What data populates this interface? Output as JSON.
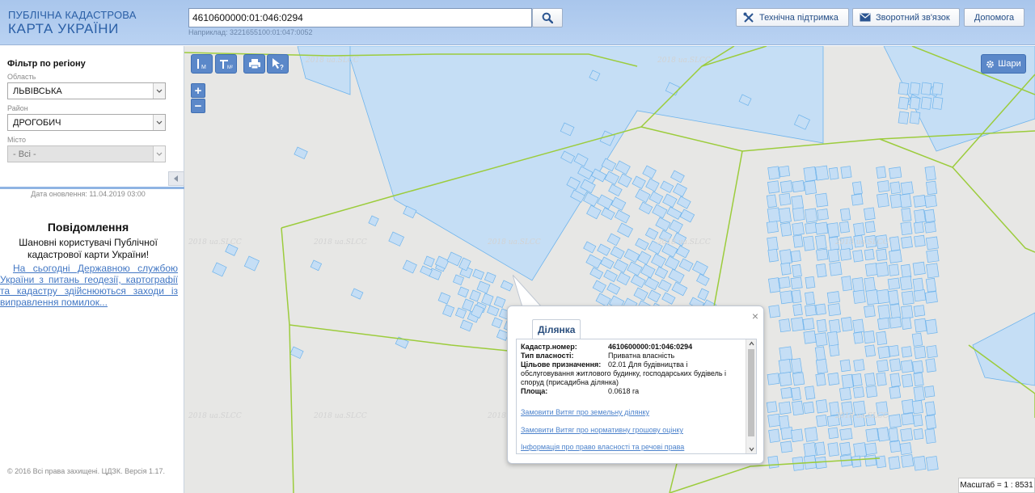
{
  "header": {
    "brand_line1": "ПУБЛІЧНА КАДАСТРОВА",
    "brand_line2": "КАРТА УКРАЇНИ",
    "search_value": "4610600000:01:046:0294",
    "search_example": "Наприклад: 3221655100:01:047:0052",
    "support_label": "Технічна підтримка",
    "feedback_label": "Зворотний зв'язок",
    "help_label": "Допомога"
  },
  "sidebar": {
    "filter_title": "Фільтр по регіону",
    "oblast_label": "Область",
    "oblast_value": "ЛЬВІВСЬКА",
    "raion_label": "Район",
    "raion_value": "ДРОГОБИЧ",
    "misto_label": "Місто",
    "misto_value": "- Всі -",
    "update_date": "Дата оновлення: 11.04.2019 03:00",
    "message_title": "Повідомлення",
    "message_greeting": "Шановні користувачі Публічної кадастрової карти України!",
    "message_link": "На сьогодні Державною службою України з питань геодезії, картографії та кадастру здійснюються заходи із виправлення помилок...",
    "copyright": "© 2016 Всі права захищені. ЦДЗК. Версія 1.17."
  },
  "map": {
    "layers_label": "Шари",
    "scale_label": "Масштаб = 1 : 8531",
    "watermark_text": "2018 ua.SLCC",
    "tools": [
      "measure-distance-icon",
      "measure-area-icon",
      "print-icon",
      "info-pointer-icon"
    ],
    "zoom_in": "+",
    "zoom_out": "−"
  },
  "popup": {
    "tab_label": "Ділянка",
    "close": "×",
    "rows": [
      {
        "key": "Кадастр.номер:",
        "value": "4610600000:01:046:0294"
      },
      {
        "key": "Тип власності:",
        "value": "Приватна власність"
      },
      {
        "key": "Цільове призначення:",
        "value": "02.01 Для будівництва і"
      },
      {
        "key": "Площа:",
        "value": "0.0618 га"
      }
    ],
    "purpose_cont1": "обслуговування житлового будинку, господарських будівель і",
    "purpose_cont2": "споруд (присадибна ділянка)",
    "link1": "Замовити Витяг про земельну ділянку",
    "link2": "Замовити Витяг про нормативну грошову оцінку",
    "link3": "Інформація про право власності та речові права"
  },
  "colors": {
    "parcel_fill": "#c5def5",
    "parcel_stroke": "#6fb4ec",
    "boundary": "#9ccc3c",
    "header_bg": "#b3cdf0",
    "tool_blue": "#5b88c9"
  }
}
